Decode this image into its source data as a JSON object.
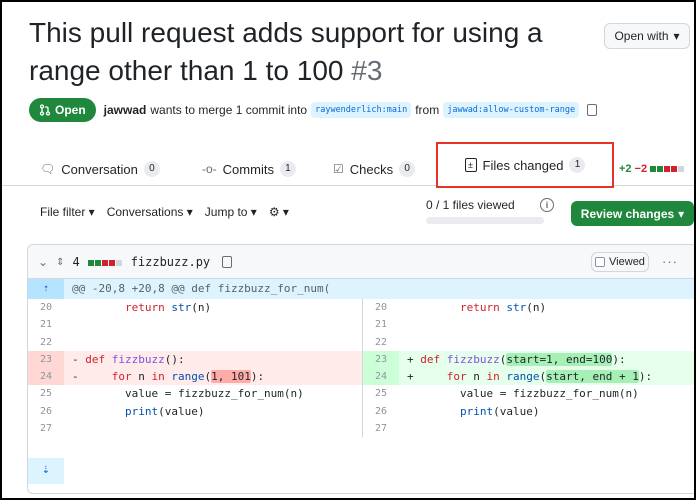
{
  "pr": {
    "title": "This pull request adds support for using a range other than 1 to 100",
    "number": "#3",
    "open_with_label": "Open with",
    "state_label": "Open",
    "author": "jawwad",
    "merge_text_1": "wants to merge 1 commit into",
    "base_branch": "raywenderlich:main",
    "merge_text_2": "from",
    "head_branch": "jawwad:allow-custom-range"
  },
  "tabs": [
    {
      "label": "Conversation",
      "count": "0",
      "icon": "comment-icon"
    },
    {
      "label": "Commits",
      "count": "1",
      "icon": "commit-icon"
    },
    {
      "label": "Checks",
      "count": "0",
      "icon": "checklist-icon"
    },
    {
      "label": "Files changed",
      "count": "1",
      "icon": "file-diff-icon",
      "active": true
    }
  ],
  "diffstat": {
    "additions": "+2",
    "deletions": "−2"
  },
  "toolbar": {
    "file_filter": "File filter",
    "conversations": "Conversations",
    "jump_to": "Jump to",
    "files_viewed": "0 / 1 files viewed",
    "review_changes": "Review changes"
  },
  "file": {
    "changes": "4",
    "name": "fizzbuzz.py",
    "viewed_label": "Viewed",
    "hunk_header": "@@ -20,8 +20,8 @@ def fizzbuzz_for_num(",
    "lines": [
      {
        "l": "20",
        "r": "20",
        "type": "ctx",
        "text": "        return str(n)"
      },
      {
        "l": "21",
        "r": "21",
        "type": "ctx",
        "text": ""
      },
      {
        "l": "22",
        "r": "22",
        "type": "ctx",
        "text": ""
      },
      {
        "l": "23",
        "r": "23",
        "type": "chg",
        "left": "- def fizzbuzz():",
        "right": "+ def fizzbuzz(start=1, end=100):"
      },
      {
        "l": "24",
        "r": "24",
        "type": "chg",
        "left": "-     for n in range(1, 101):",
        "right": "+     for n in range(start, end + 1):"
      },
      {
        "l": "25",
        "r": "25",
        "type": "ctx",
        "text": "        value = fizzbuzz_for_num(n)"
      },
      {
        "l": "26",
        "r": "26",
        "type": "ctx",
        "text": "        print(value)"
      },
      {
        "l": "27",
        "r": "27",
        "type": "ctx",
        "text": ""
      }
    ]
  },
  "colors": {
    "accent_green": "#1f883d",
    "highlight_red": "#e63227",
    "link_blue": "#0969da"
  }
}
